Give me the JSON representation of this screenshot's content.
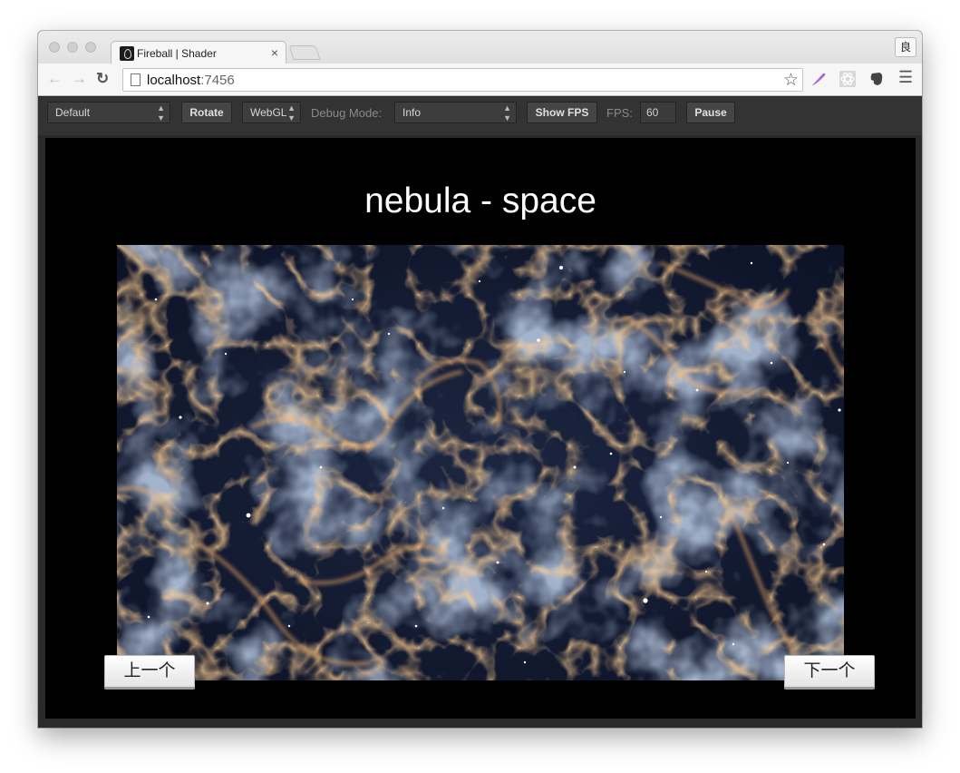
{
  "browser": {
    "tab_title": "Fireball | Shader",
    "tab_close": "×",
    "profile_label": "良",
    "url_host": "localhost",
    "url_port": ":7456"
  },
  "toolbar": {
    "scene_select": "Default",
    "rotate_label": "Rotate",
    "renderer_select": "WebGL",
    "debug_mode_label": "Debug Mode:",
    "debug_mode_select": "Info",
    "show_fps_label": "Show FPS",
    "fps_label": "FPS:",
    "fps_value": "60",
    "pause_label": "Pause"
  },
  "stage": {
    "title": "nebula - space",
    "prev_label": "上一个",
    "next_label": "下一个"
  },
  "icons": {
    "back": "arrow-left-icon",
    "forward": "arrow-right-icon",
    "reload": "reload-icon",
    "star": "star-icon",
    "menu": "hamburger-menu-icon"
  }
}
